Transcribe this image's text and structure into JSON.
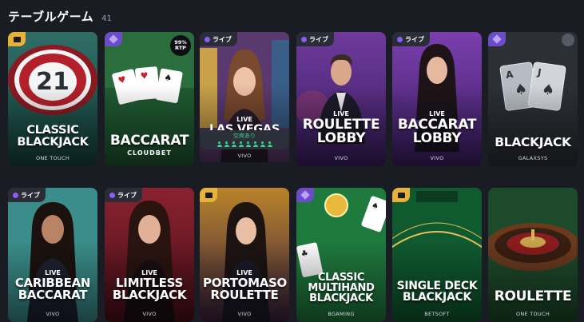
{
  "section": {
    "title": "テーブルゲーム",
    "count": "41"
  },
  "badges": {
    "live": "ライブ",
    "live_tag": "LIVE",
    "rtp_value": "99%",
    "rtp_label": "RTP"
  },
  "availability": {
    "text": "空席あり",
    "seats": 8
  },
  "colors": {
    "background": "#1a1c24",
    "live_dot": "#8b5cf6",
    "avail_green": "#3fcf8e",
    "badge_gold": "#e8b23a",
    "badge_purple": "#6d4cc7"
  },
  "cards": [
    {
      "name": "CLASSIC\nBLACKJACK",
      "provider": "ONE TOUCH",
      "live": false,
      "badge": "wallet-icon",
      "art": "chip-21"
    },
    {
      "name": "BACCARAT",
      "provider": "CLOUDBET",
      "live": false,
      "badge": "gem-icon",
      "rtp": true,
      "art": "cards-green"
    },
    {
      "name": "LAS VEGAS\nBLACKJACK",
      "provider": "VIVO",
      "live": true,
      "art": "dealer-casino"
    },
    {
      "name": "ROULETTE\nLOBBY",
      "provider": "VIVO",
      "live": true,
      "art": "dealer-male-purple"
    },
    {
      "name": "BACCARAT\nLOBBY",
      "provider": "VIVO",
      "live": true,
      "art": "dealer-female-purple"
    },
    {
      "name": "BLACKJACK",
      "provider": "GALAXSYS",
      "live": false,
      "badge": "gem-icon",
      "art": "cards-dark"
    },
    {
      "name": "CARIBBEAN\nBACCARAT",
      "provider": "VIVO",
      "live": true,
      "art": "dealer-teal"
    },
    {
      "name": "LIMITLESS\nBLACKJACK",
      "provider": "VIVO",
      "live": true,
      "art": "dealer-red"
    },
    {
      "name": "PORTOMASO\nROULETTE",
      "provider": "VIVO",
      "live": true,
      "badge": "wallet-icon",
      "art": "dealer-gold"
    },
    {
      "name": "CLASSIC\nMULTIHAND\nBLACKJACK",
      "provider": "BGAMING",
      "live": false,
      "badge": "gem-icon",
      "art": "cards-table"
    },
    {
      "name": "SINGLE DECK\nBLACKJACK",
      "provider": "BETSOFT",
      "live": false,
      "badge": "wallet-icon",
      "art": "felt-table"
    },
    {
      "name": "ROULETTE",
      "provider": "ONE TOUCH",
      "live": false,
      "art": "wheel"
    }
  ]
}
